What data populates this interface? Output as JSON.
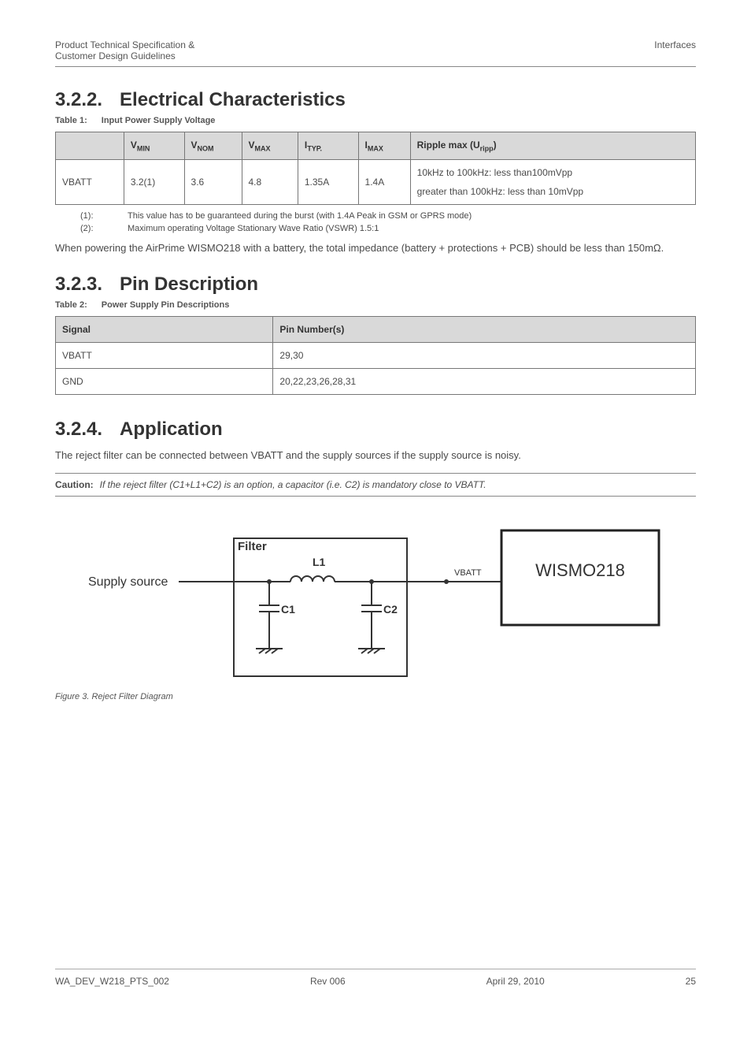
{
  "header": {
    "left": "Product Technical Specification &\nCustomer Design Guidelines",
    "right": "Interfaces"
  },
  "s322": {
    "num": "3.2.2.",
    "title": "Electrical Characteristics",
    "table_caption_label": "Table 1:",
    "table_caption_text": "Input Power Supply Voltage",
    "columns": {
      "c0": "",
      "c1": "V",
      "c1sub": "MIN",
      "c2": "V",
      "c2sub": "NOM",
      "c3": "V",
      "c3sub": "MAX",
      "c4": "I",
      "c4sub": "TYP.",
      "c5": "I",
      "c5sub": "MAX",
      "c6": "Ripple max (U",
      "c6sub": "ripp",
      "c6suffix": ")"
    },
    "row": {
      "name": "VBATT",
      "vmin": "3.2(1)",
      "vnom": "3.6",
      "vmax": "4.8",
      "ityp": "1.35A",
      "imax": "1.4A",
      "ripple_a": "10kHz to 100kHz: less than100mVpp",
      "ripple_b": "greater than 100kHz: less than 10mVpp"
    },
    "footnotes": {
      "f1_label": "(1):",
      "f1_text": "This value has to be guaranteed during the burst (with 1.4A Peak in GSM or GPRS mode)",
      "f2_label": "(2):",
      "f2_text": "Maximum operating Voltage Stationary Wave Ratio (VSWR) 1.5:1"
    },
    "body": "When powering the AirPrime WISMO218 with a battery, the total impedance (battery + protections + PCB) should be less than 150mΩ."
  },
  "s323": {
    "num": "3.2.3.",
    "title": "Pin Description",
    "table_caption_label": "Table 2:",
    "table_caption_text": "Power Supply Pin Descriptions",
    "col_signal": "Signal",
    "col_pins": "Pin Number(s)",
    "rows": [
      {
        "signal": "VBATT",
        "pins": "29,30"
      },
      {
        "signal": "GND",
        "pins": "20,22,23,26,28,31"
      }
    ]
  },
  "s324": {
    "num": "3.2.4.",
    "title": "Application",
    "body": "The reject filter can be connected between VBATT and the supply sources if the supply source is noisy.",
    "caution_label": "Caution:",
    "caution_text": "If the reject filter (C1+L1+C2) is an option, a capacitor (i.e. C2) is mandatory close to VBATT.",
    "diagram": {
      "supply_source": "Supply source",
      "filter": "Filter",
      "l1": "L1",
      "c1": "C1",
      "c2": "C2",
      "vbatt": "VBATT",
      "module": "WISMO218"
    },
    "fig_caption": "Figure 3.  Reject Filter Diagram"
  },
  "footer": {
    "doc": "WA_DEV_W218_PTS_002",
    "rev": "Rev 006",
    "date": "April 29, 2010",
    "page": "25"
  }
}
